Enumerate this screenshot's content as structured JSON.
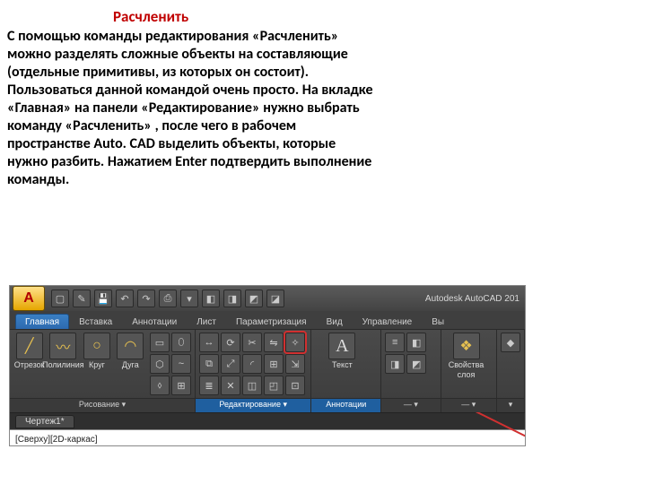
{
  "doc": {
    "title": "Расчленить",
    "body": "С помощью команды редактирования «Расчленить» можно разделять сложные объекты на составляющие (отдельные примитивы, из которых он состоит). Пользоваться данной командой очень просто. На вкладке «Главная» на панели «Редактирование» нужно выбрать команду «Расчленить» , после чего в рабочем пространстве Auto. CAD выделить объекты, которые нужно разбить. Нажатием Enter подтвердить выполнение команды."
  },
  "autocad": {
    "product": "Autodesk AutoCAD 201",
    "appmenu_glyph": "A",
    "qat_icons": [
      "new",
      "open",
      "save",
      "undo",
      "redo",
      "plot",
      "arrow",
      "arrow",
      "arrow",
      "arrow",
      "arrow"
    ],
    "tabs": [
      "Главная",
      "Вставка",
      "Аннотации",
      "Лист",
      "Параметризация",
      "Вид",
      "Управление",
      "Вы"
    ],
    "active_tab": 0,
    "draw_panel": {
      "title": "Рисование",
      "buttons": [
        "Отрезок",
        "Полилиния",
        "Круг",
        "Дуга"
      ]
    },
    "modify_panel": {
      "title": "Редактирование",
      "explode_highlighted": true
    },
    "annot_panel": {
      "title": "Аннотации",
      "text_btn": "A",
      "text_label": "Текст"
    },
    "prop_panel": {
      "title_line1": "Свойства",
      "title_line2": "слоя"
    },
    "doc_tab": "Чертеж1*",
    "view_label": "[Сверху][2D-каркас]"
  }
}
